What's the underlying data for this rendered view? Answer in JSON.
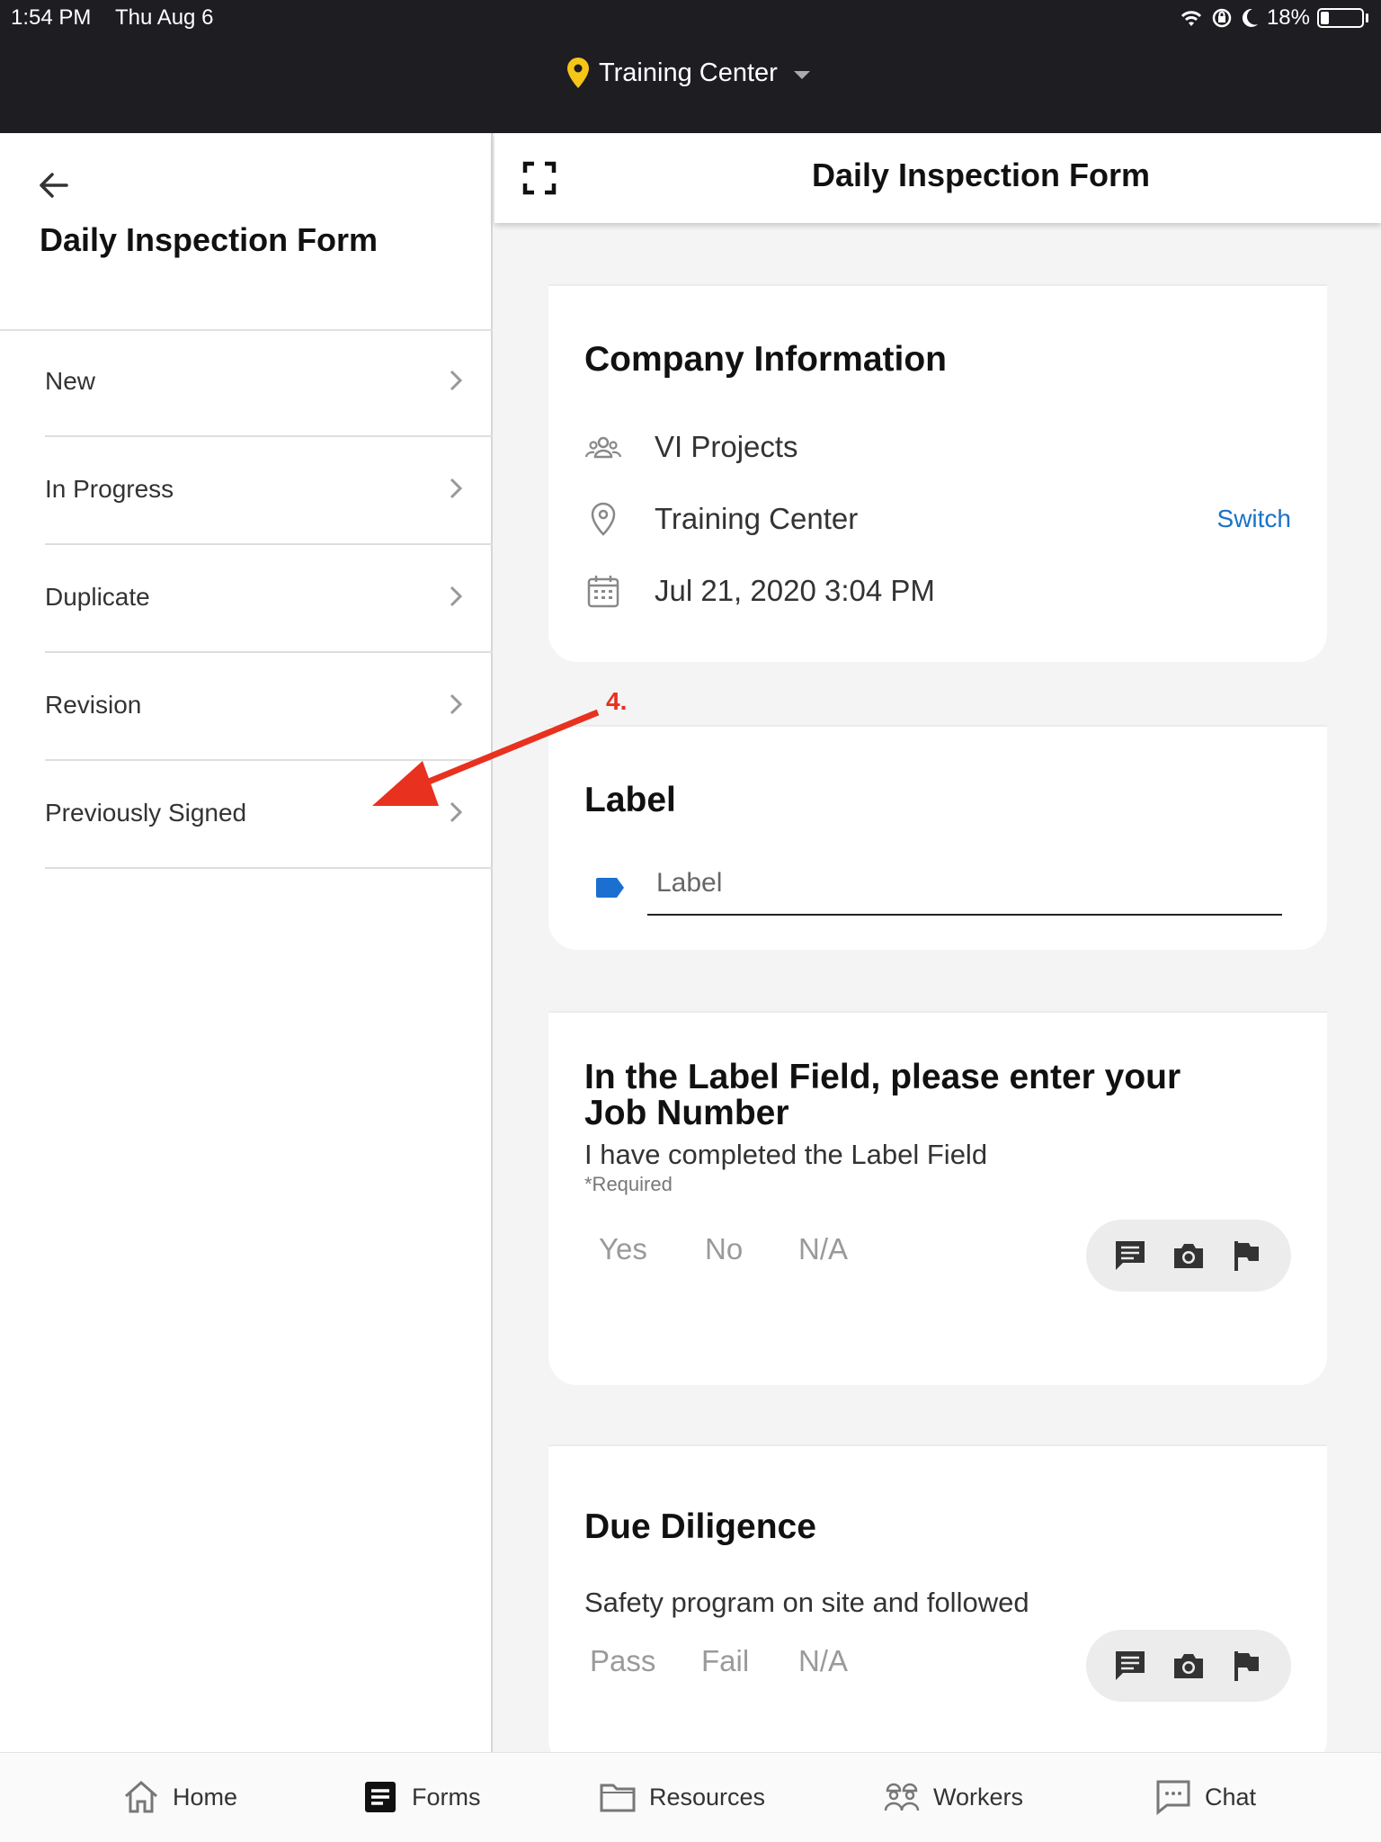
{
  "status_bar": {
    "time": "1:54 PM",
    "date": "Thu Aug 6",
    "battery": "18%"
  },
  "header": {
    "location": "Training Center"
  },
  "left_panel": {
    "title": "Daily Inspection Form",
    "items": [
      {
        "label": "New"
      },
      {
        "label": "In Progress"
      },
      {
        "label": "Duplicate"
      },
      {
        "label": "Revision"
      },
      {
        "label": "Previously Signed"
      }
    ]
  },
  "right_panel": {
    "title": "Daily Inspection Form"
  },
  "company_card": {
    "title": "Company Information",
    "company": "VI Projects",
    "location": "Training Center",
    "switch_label": "Switch",
    "datetime": "Jul 21, 2020 3:04 PM"
  },
  "label_card": {
    "title": "Label",
    "placeholder": "Label"
  },
  "question_card": {
    "title_line1": "In the Label Field, please enter your",
    "title_line2": "Job Number",
    "subtitle": "I have completed the Label Field",
    "required": "*Required",
    "options": [
      "Yes",
      "No",
      "N/A"
    ]
  },
  "diligence_card": {
    "title": "Due Diligence",
    "subtitle": "Safety program on site and followed",
    "options": [
      "Pass",
      "Fail",
      "N/A"
    ]
  },
  "annotation": {
    "number": "4.",
    "color": "#e8311f"
  },
  "tabbar": {
    "tabs": [
      {
        "label": "Home",
        "icon": "home-icon"
      },
      {
        "label": "Forms",
        "icon": "forms-icon"
      },
      {
        "label": "Resources",
        "icon": "folder-icon"
      },
      {
        "label": "Workers",
        "icon": "workers-icon"
      },
      {
        "label": "Chat",
        "icon": "chat-icon"
      }
    ]
  },
  "colors": {
    "header_bg": "#1d1d22",
    "pin": "#f5c518",
    "link": "#1a73c8",
    "label_tag": "#1a6fd1"
  }
}
